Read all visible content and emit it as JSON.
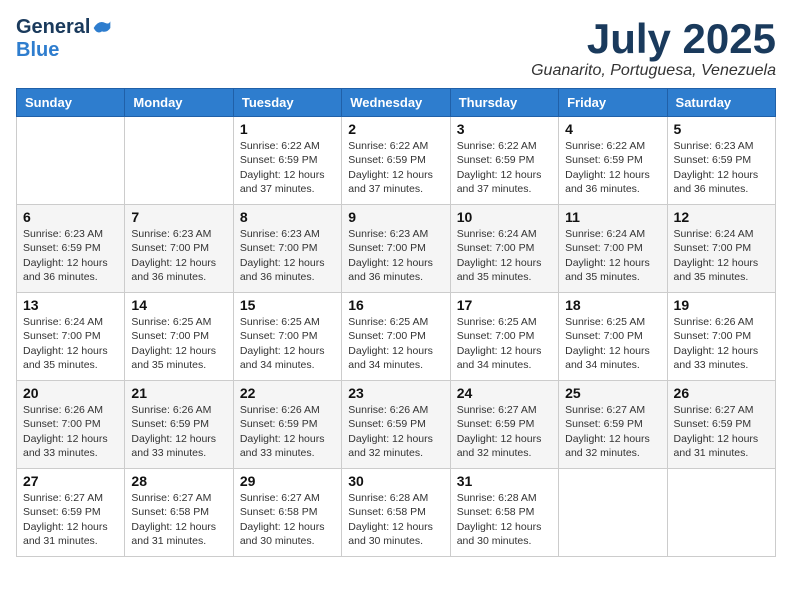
{
  "logo": {
    "general": "General",
    "blue": "Blue"
  },
  "header": {
    "month": "July 2025",
    "location": "Guanarito, Portuguesa, Venezuela"
  },
  "weekdays": [
    "Sunday",
    "Monday",
    "Tuesday",
    "Wednesday",
    "Thursday",
    "Friday",
    "Saturday"
  ],
  "weeks": [
    [
      {
        "day": "",
        "info": ""
      },
      {
        "day": "",
        "info": ""
      },
      {
        "day": "1",
        "info": "Sunrise: 6:22 AM\nSunset: 6:59 PM\nDaylight: 12 hours and 37 minutes."
      },
      {
        "day": "2",
        "info": "Sunrise: 6:22 AM\nSunset: 6:59 PM\nDaylight: 12 hours and 37 minutes."
      },
      {
        "day": "3",
        "info": "Sunrise: 6:22 AM\nSunset: 6:59 PM\nDaylight: 12 hours and 37 minutes."
      },
      {
        "day": "4",
        "info": "Sunrise: 6:22 AM\nSunset: 6:59 PM\nDaylight: 12 hours and 36 minutes."
      },
      {
        "day": "5",
        "info": "Sunrise: 6:23 AM\nSunset: 6:59 PM\nDaylight: 12 hours and 36 minutes."
      }
    ],
    [
      {
        "day": "6",
        "info": "Sunrise: 6:23 AM\nSunset: 6:59 PM\nDaylight: 12 hours and 36 minutes."
      },
      {
        "day": "7",
        "info": "Sunrise: 6:23 AM\nSunset: 7:00 PM\nDaylight: 12 hours and 36 minutes."
      },
      {
        "day": "8",
        "info": "Sunrise: 6:23 AM\nSunset: 7:00 PM\nDaylight: 12 hours and 36 minutes."
      },
      {
        "day": "9",
        "info": "Sunrise: 6:23 AM\nSunset: 7:00 PM\nDaylight: 12 hours and 36 minutes."
      },
      {
        "day": "10",
        "info": "Sunrise: 6:24 AM\nSunset: 7:00 PM\nDaylight: 12 hours and 35 minutes."
      },
      {
        "day": "11",
        "info": "Sunrise: 6:24 AM\nSunset: 7:00 PM\nDaylight: 12 hours and 35 minutes."
      },
      {
        "day": "12",
        "info": "Sunrise: 6:24 AM\nSunset: 7:00 PM\nDaylight: 12 hours and 35 minutes."
      }
    ],
    [
      {
        "day": "13",
        "info": "Sunrise: 6:24 AM\nSunset: 7:00 PM\nDaylight: 12 hours and 35 minutes."
      },
      {
        "day": "14",
        "info": "Sunrise: 6:25 AM\nSunset: 7:00 PM\nDaylight: 12 hours and 35 minutes."
      },
      {
        "day": "15",
        "info": "Sunrise: 6:25 AM\nSunset: 7:00 PM\nDaylight: 12 hours and 34 minutes."
      },
      {
        "day": "16",
        "info": "Sunrise: 6:25 AM\nSunset: 7:00 PM\nDaylight: 12 hours and 34 minutes."
      },
      {
        "day": "17",
        "info": "Sunrise: 6:25 AM\nSunset: 7:00 PM\nDaylight: 12 hours and 34 minutes."
      },
      {
        "day": "18",
        "info": "Sunrise: 6:25 AM\nSunset: 7:00 PM\nDaylight: 12 hours and 34 minutes."
      },
      {
        "day": "19",
        "info": "Sunrise: 6:26 AM\nSunset: 7:00 PM\nDaylight: 12 hours and 33 minutes."
      }
    ],
    [
      {
        "day": "20",
        "info": "Sunrise: 6:26 AM\nSunset: 7:00 PM\nDaylight: 12 hours and 33 minutes."
      },
      {
        "day": "21",
        "info": "Sunrise: 6:26 AM\nSunset: 6:59 PM\nDaylight: 12 hours and 33 minutes."
      },
      {
        "day": "22",
        "info": "Sunrise: 6:26 AM\nSunset: 6:59 PM\nDaylight: 12 hours and 33 minutes."
      },
      {
        "day": "23",
        "info": "Sunrise: 6:26 AM\nSunset: 6:59 PM\nDaylight: 12 hours and 32 minutes."
      },
      {
        "day": "24",
        "info": "Sunrise: 6:27 AM\nSunset: 6:59 PM\nDaylight: 12 hours and 32 minutes."
      },
      {
        "day": "25",
        "info": "Sunrise: 6:27 AM\nSunset: 6:59 PM\nDaylight: 12 hours and 32 minutes."
      },
      {
        "day": "26",
        "info": "Sunrise: 6:27 AM\nSunset: 6:59 PM\nDaylight: 12 hours and 31 minutes."
      }
    ],
    [
      {
        "day": "27",
        "info": "Sunrise: 6:27 AM\nSunset: 6:59 PM\nDaylight: 12 hours and 31 minutes."
      },
      {
        "day": "28",
        "info": "Sunrise: 6:27 AM\nSunset: 6:58 PM\nDaylight: 12 hours and 31 minutes."
      },
      {
        "day": "29",
        "info": "Sunrise: 6:27 AM\nSunset: 6:58 PM\nDaylight: 12 hours and 30 minutes."
      },
      {
        "day": "30",
        "info": "Sunrise: 6:28 AM\nSunset: 6:58 PM\nDaylight: 12 hours and 30 minutes."
      },
      {
        "day": "31",
        "info": "Sunrise: 6:28 AM\nSunset: 6:58 PM\nDaylight: 12 hours and 30 minutes."
      },
      {
        "day": "",
        "info": ""
      },
      {
        "day": "",
        "info": ""
      }
    ]
  ]
}
